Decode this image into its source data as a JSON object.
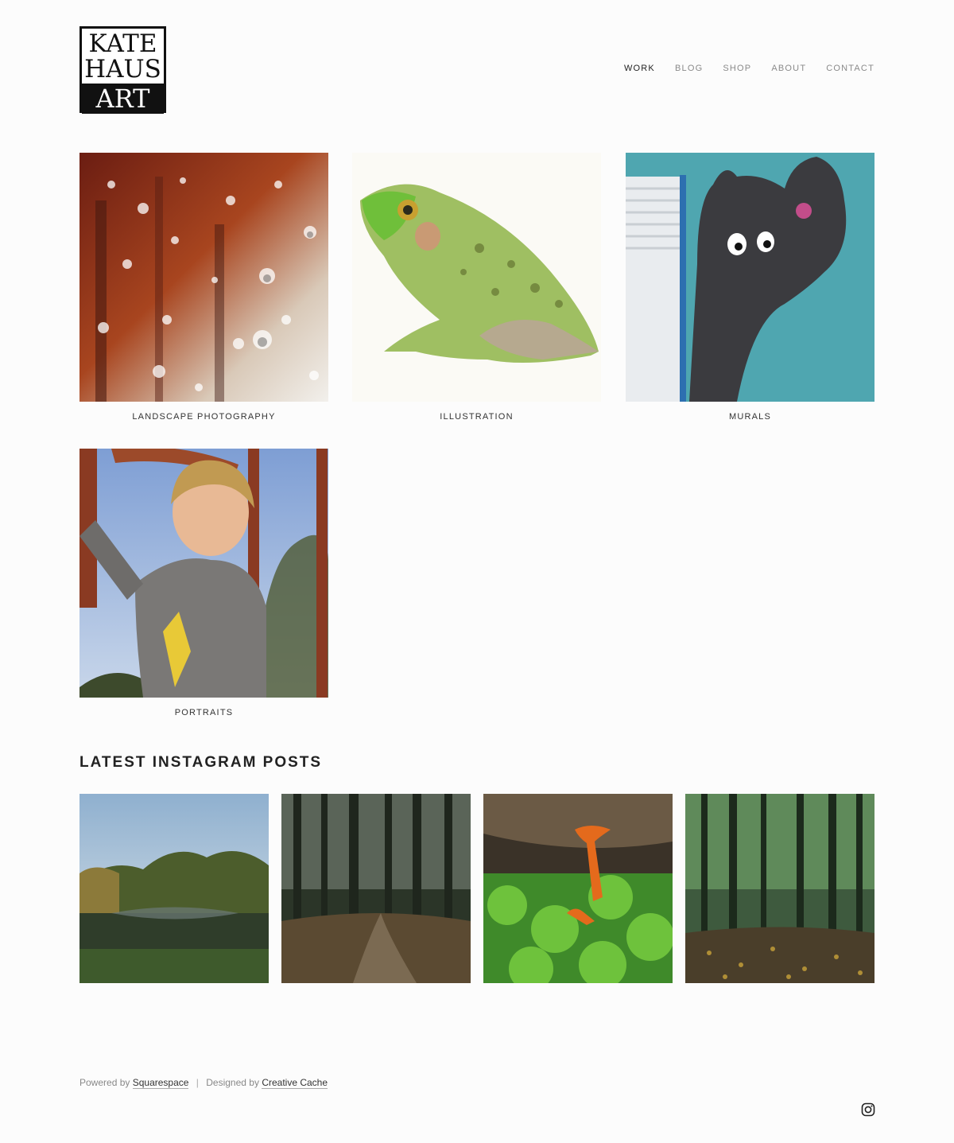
{
  "logo": {
    "line1": "KATE",
    "line2": "HAUS",
    "line3": "ART"
  },
  "nav": [
    {
      "label": "WORK",
      "active": true
    },
    {
      "label": "BLOG"
    },
    {
      "label": "SHOP"
    },
    {
      "label": "ABOUT"
    },
    {
      "label": "CONTACT"
    }
  ],
  "gallery": [
    {
      "caption": "LANDSCAPE PHOTOGRAPHY"
    },
    {
      "caption": "ILLUSTRATION"
    },
    {
      "caption": "MURALS"
    },
    {
      "caption": "PORTRAITS"
    }
  ],
  "instagram": {
    "title": "LATEST INSTAGRAM POSTS"
  },
  "footer": {
    "powered_prefix": "Powered by",
    "powered_link": "Squarespace",
    "separator": "|",
    "designed_prefix": "Designed by",
    "designed_link": "Creative Cache"
  },
  "icons": {
    "social": "instagram-icon"
  }
}
